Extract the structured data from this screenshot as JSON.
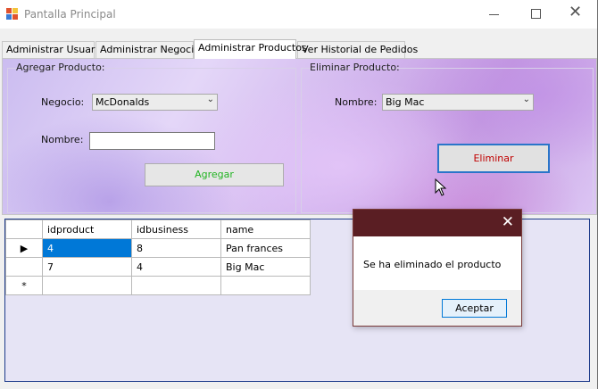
{
  "window": {
    "title": "Pantalla Principal"
  },
  "tabs": [
    {
      "label": "Administrar Usuarios"
    },
    {
      "label": "Administrar Negocios"
    },
    {
      "label": "Administrar Productos",
      "active": true
    },
    {
      "label": "Ver Historial de Pedidos"
    }
  ],
  "add_product": {
    "group_label": "Agregar Producto:",
    "business_label": "Negocio:",
    "business_value": "McDonalds",
    "name_label": "Nombre:",
    "name_value": "",
    "add_button": "Agregar",
    "add_button_color": "#22b422"
  },
  "remove_product": {
    "group_label": "Eliminar Producto:",
    "name_label": "Nombre:",
    "name_value": "Big Mac",
    "remove_button": "Eliminar",
    "remove_button_color": "#c00000"
  },
  "grid": {
    "columns": [
      "idproduct",
      "idbusiness",
      "name"
    ],
    "rows": [
      {
        "idproduct": "4",
        "idbusiness": "8",
        "name": "Pan frances"
      },
      {
        "idproduct": "7",
        "idbusiness": "4",
        "name": "Big Mac"
      }
    ],
    "new_row_marker": "*"
  },
  "dialog": {
    "message": "Se ha eliminado el producto",
    "ok_button": "Aceptar",
    "title_color": "#5a1e23"
  },
  "icons": {
    "app": "app-grid-icon",
    "minimize": "minimize-icon",
    "maximize": "maximize-icon",
    "close": "close-icon",
    "current_row": "row-pointer-icon",
    "dropdown": "chevron-down-icon"
  }
}
